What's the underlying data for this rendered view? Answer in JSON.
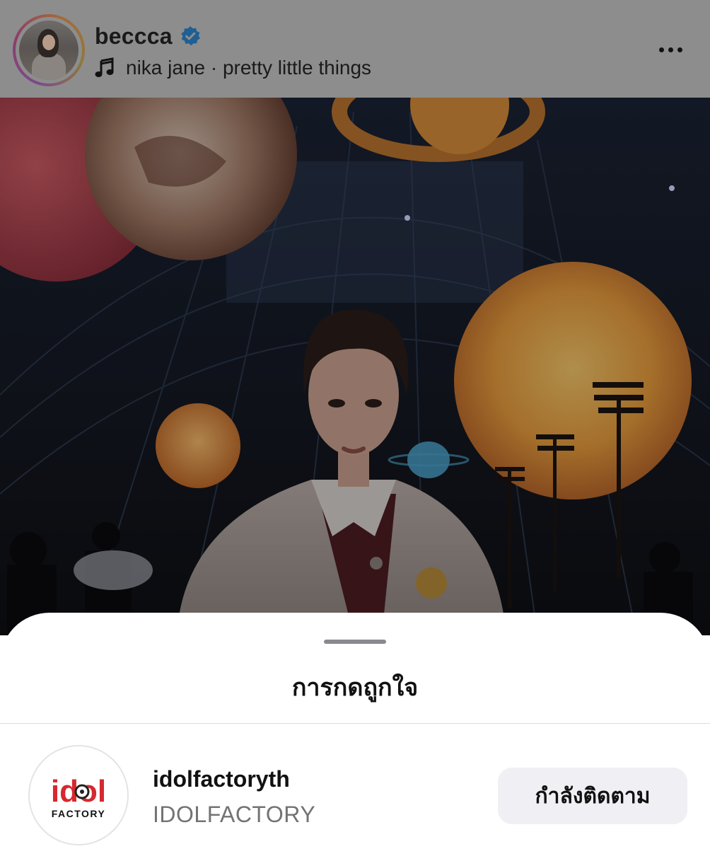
{
  "post": {
    "username": "beccca",
    "verified": true,
    "music": "nika jane · pretty little things",
    "icons": {
      "verified": "verified-badge-icon",
      "music": "music-note-icon",
      "more": "more-horizontal-icon"
    }
  },
  "likes_sheet": {
    "title": "การกดถูกใจ",
    "items": [
      {
        "username": "idolfactoryth",
        "full_name": "IDOLFACTORY",
        "logo_text": "idol",
        "logo_subtext": "FACTORY",
        "follow_label": "กำลังติดตาม"
      }
    ]
  },
  "colors": {
    "dim_overlay": "#8d8d8d",
    "verified_blue": "#1f5f93",
    "logo_red": "#d7282f",
    "button_bg": "#efeff4",
    "secondary_text": "#737373"
  }
}
